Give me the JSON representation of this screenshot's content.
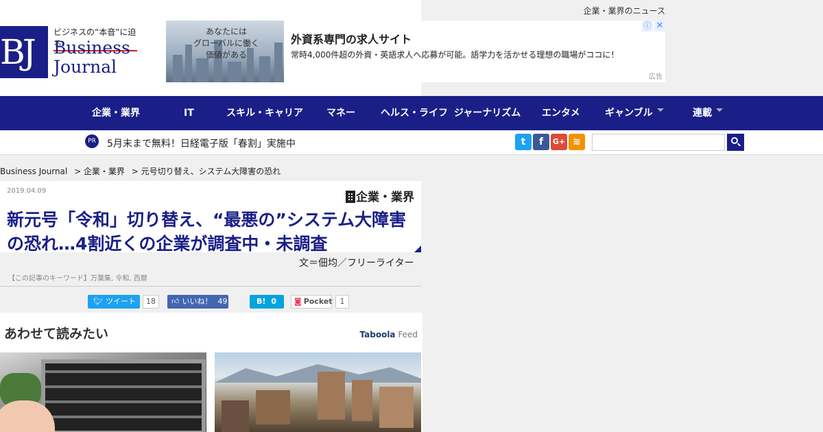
{
  "header": {
    "top_link": "企業・業界のニュース",
    "logo": {
      "mark": "BJ",
      "tagline": "ビジネスの“本音”に迫る",
      "name_line1": "Business",
      "name_line2": "Journal"
    }
  },
  "ad": {
    "image_text": "あなたには\nグローバルに働く\n価値がある",
    "title": "外資系専門の求人サイト",
    "description": "常時4,000件超の外資・英語求人へ応募が可能。語学力を活かせる理想の職場がココに！",
    "label": "広告",
    "info_icon": "ⓘ",
    "close_icon": "✕"
  },
  "nav": {
    "items": [
      {
        "label": "企業・業界"
      },
      {
        "label": "IT"
      },
      {
        "label": "スキル・キャリア"
      },
      {
        "label": "マネー"
      },
      {
        "label": "ヘルス・ライフ"
      },
      {
        "label": "ジャーナリズム"
      },
      {
        "label": "エンタメ"
      },
      {
        "label": "ギャンブル"
      },
      {
        "label": "連載"
      }
    ]
  },
  "subbar": {
    "pr_badge": "PR",
    "pr_text": "5月末まで無料！日経電子版「春割」実施中",
    "social": [
      {
        "icon": "twitter-icon",
        "glyph": "t",
        "color": "#1da1f2"
      },
      {
        "icon": "facebook-icon",
        "glyph": "f",
        "color": "#3b5998"
      },
      {
        "icon": "googleplus-icon",
        "glyph": "G+",
        "color": "#dd4b39"
      },
      {
        "icon": "rss-icon",
        "glyph": "≋",
        "color": "#f39200"
      }
    ],
    "search_placeholder": ""
  },
  "breadcrumb": {
    "items": [
      "Business Journal",
      "> 企業・業界",
      "> 元号切り替え、システム大障害の恐れ"
    ]
  },
  "article": {
    "date": "2019.04.09",
    "category": "企業・業界",
    "headline": "新元号「令和」切り替え、“最悪の”システム大障害の恐れ…4割近くの企業が調査中・未調査",
    "author": "文＝佃均／フリーライター",
    "keywords": "【この記事のキーワード】万葉集, 令和, 西暦"
  },
  "share": {
    "tweet_label": "ツイート",
    "tweet_count": "18",
    "like_label": "いいね！",
    "like_count": "49",
    "hatena_label": "B!",
    "hatena_count": "0",
    "pocket_label": "Pocket",
    "pocket_count": "1"
  },
  "related": {
    "title": "あわせて読みたい",
    "provider_brand": "Taboola",
    "provider_suffix": "Feed"
  }
}
